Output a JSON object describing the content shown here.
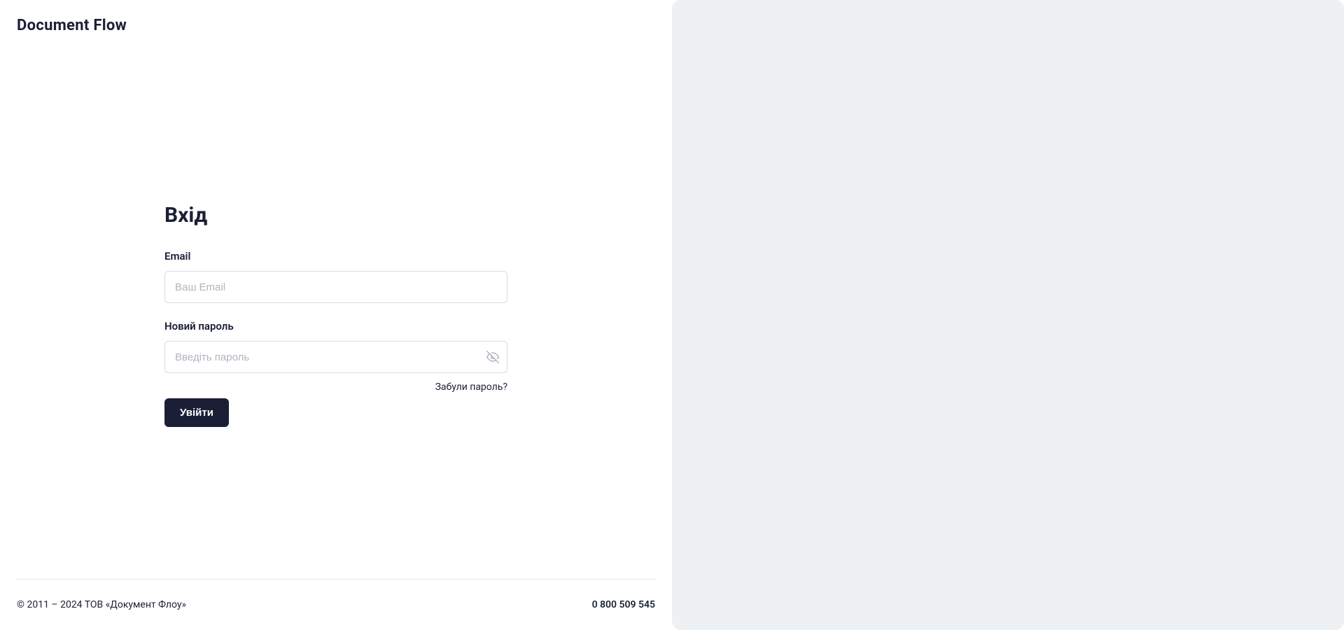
{
  "brand": "Document Flow",
  "form": {
    "title": "Вхід",
    "email_label": "Еmail",
    "email_placeholder": "Ваш Email",
    "password_label": "Новий пароль",
    "password_placeholder": "Введіть пароль",
    "forgot_link": "Забули пароль?",
    "submit_label": "Увійти"
  },
  "footer": {
    "copyright": "© 2011 – 2024 ТОВ «Документ Флоу»",
    "phone": "0 800 509 545"
  }
}
